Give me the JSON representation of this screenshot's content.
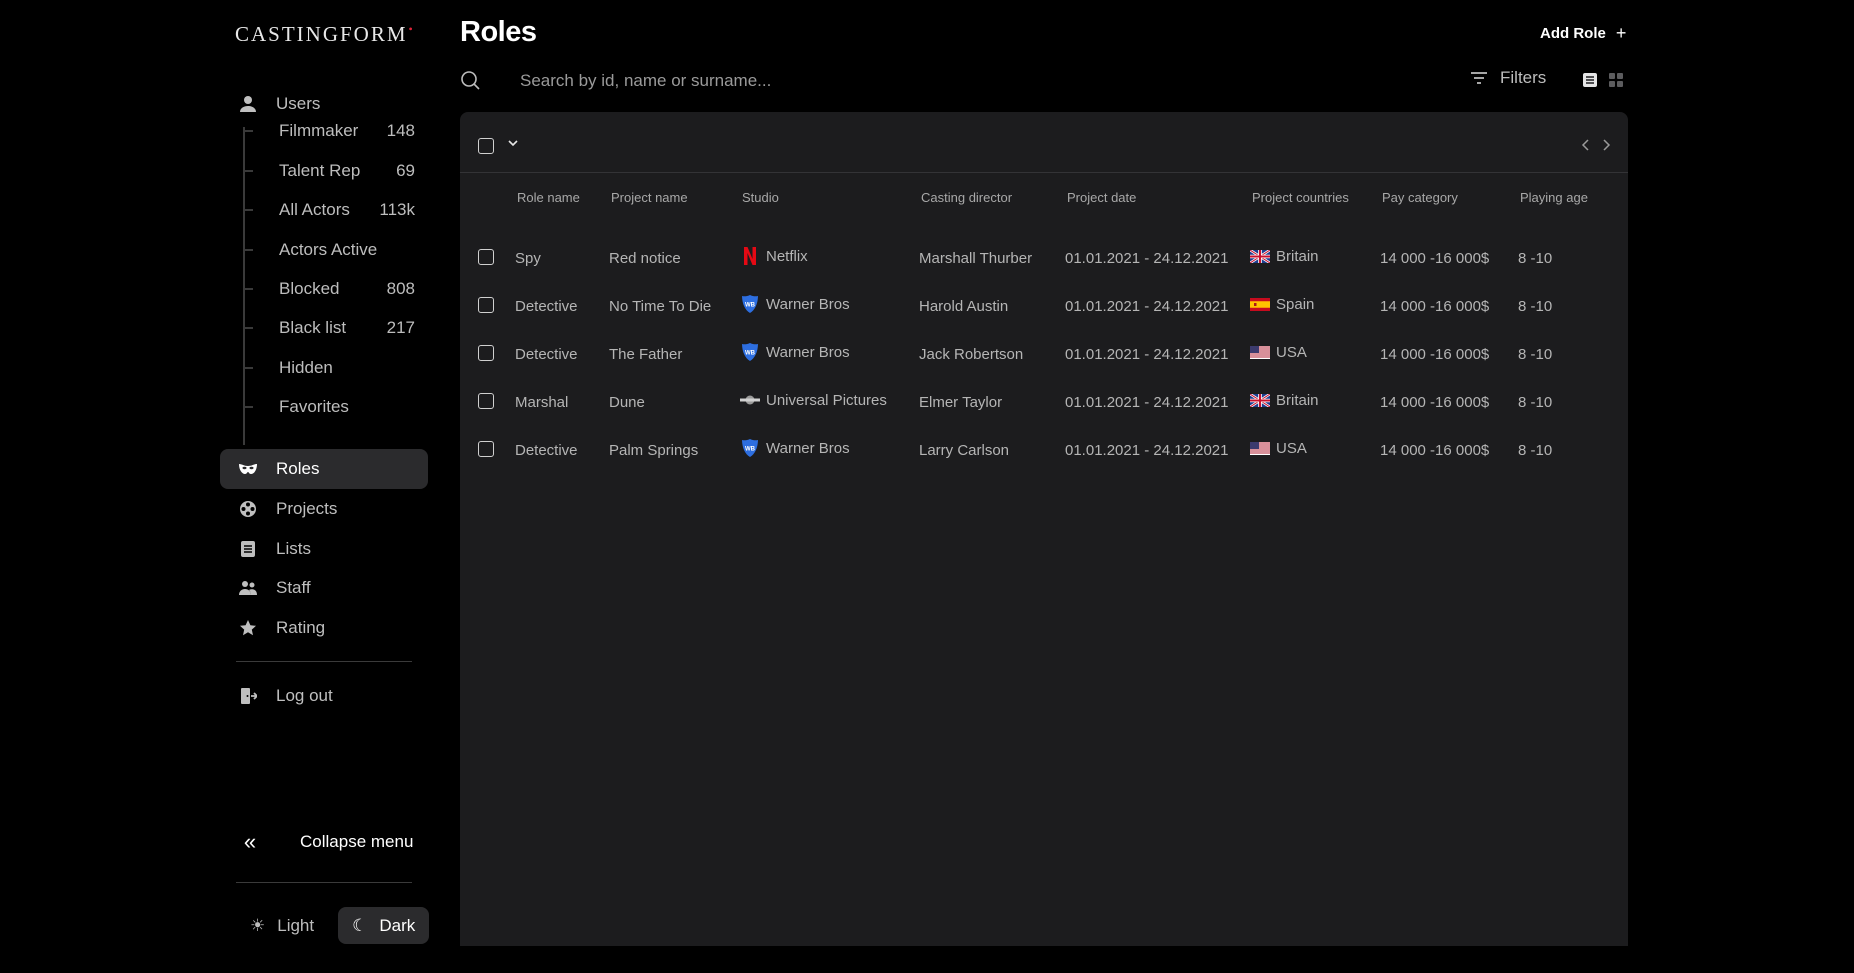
{
  "brand": {
    "name": "CASTINGFORM",
    "accent": "#e0243a"
  },
  "sidebar": {
    "users_label": "Users",
    "sub_items": [
      {
        "label": "Filmmaker",
        "count": "148"
      },
      {
        "label": "Talent Rep",
        "count": "69"
      },
      {
        "label": "All Actors",
        "count": "113k"
      },
      {
        "label": "Actors Active",
        "count": ""
      },
      {
        "label": "Blocked",
        "count": "808"
      },
      {
        "label": "Black list",
        "count": "217"
      },
      {
        "label": "Hidden",
        "count": ""
      },
      {
        "label": "Favorites",
        "count": ""
      }
    ],
    "nav": [
      {
        "label": "Roles",
        "icon": "mask-icon",
        "active": true
      },
      {
        "label": "Projects",
        "icon": "film-reel-icon",
        "active": false
      },
      {
        "label": "Lists",
        "icon": "list-icon",
        "active": false
      },
      {
        "label": "Staff",
        "icon": "staff-icon",
        "active": false
      },
      {
        "label": "Rating",
        "icon": "star-icon",
        "active": false
      }
    ],
    "logout_label": "Log out",
    "collapse_label": "Collapse menu",
    "theme": {
      "light_label": "Light",
      "dark_label": "Dark",
      "selected": "Dark"
    }
  },
  "header": {
    "title": "Roles",
    "add_label": "Add Role",
    "search_placeholder": "Search by id, name or surname...",
    "filters_label": "Filters"
  },
  "table": {
    "columns": [
      "Role name",
      "Project name",
      "Studio",
      "Casting director",
      "Project date",
      "Project countries",
      "Pay category",
      "Playing age"
    ],
    "rows": [
      {
        "role": "Spy",
        "project": "Red notice",
        "studio": "Netflix",
        "studio_icon": "netflix-logo-icon",
        "director": "Marshall Thurber",
        "date": "01.01.2021 - 24.12.2021",
        "country": "Britain",
        "flag": "uk-flag-icon",
        "pay": "14 000 -16 000$",
        "age": "8 -10"
      },
      {
        "role": "Detective",
        "project": "No Time To Die",
        "studio": "Warner Bros",
        "studio_icon": "warner-bros-logo-icon",
        "director": "Harold Austin",
        "date": "01.01.2021 - 24.12.2021",
        "country": "Spain",
        "flag": "spain-flag-icon",
        "pay": "14 000 -16 000$",
        "age": "8 -10"
      },
      {
        "role": "Detective",
        "project": "The Father",
        "studio": "Warner Bros",
        "studio_icon": "warner-bros-logo-icon",
        "director": "Jack Robertson",
        "date": "01.01.2021 - 24.12.2021",
        "country": "USA",
        "flag": "usa-flag-icon",
        "pay": "14 000 -16 000$",
        "age": "8 -10"
      },
      {
        "role": "Marshal",
        "project": "Dune",
        "studio": "Universal Pictures",
        "studio_icon": "universal-logo-icon",
        "director": "Elmer Taylor",
        "date": "01.01.2021 - 24.12.2021",
        "country": "Britain",
        "flag": "uk-flag-icon",
        "pay": "14 000 -16 000$",
        "age": "8 -10"
      },
      {
        "role": "Detective",
        "project": "Palm Springs",
        "studio": "Warner Bros",
        "studio_icon": "warner-bros-logo-icon",
        "director": "Larry Carlson",
        "date": "01.01.2021 - 24.12.2021",
        "country": "USA",
        "flag": "usa-flag-icon",
        "pay": "14 000 -16 000$",
        "age": "8 -10"
      }
    ]
  }
}
